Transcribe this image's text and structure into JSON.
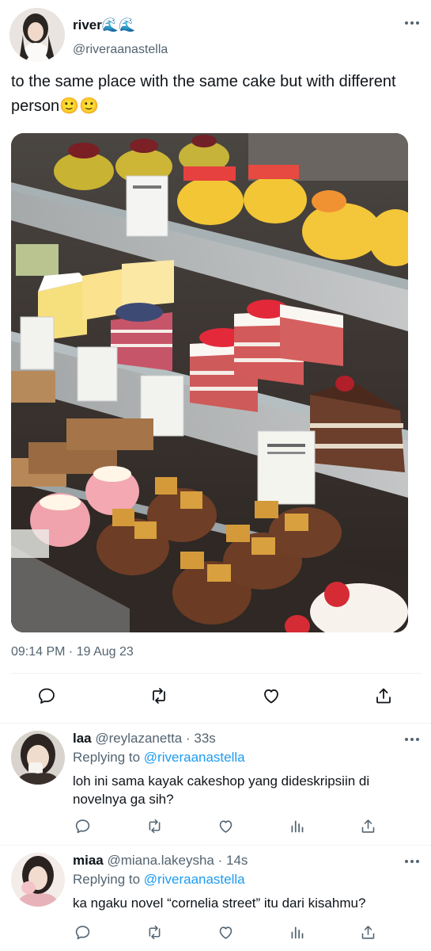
{
  "tweet": {
    "author_name": "river🌊🌊",
    "author_handle": "@riveraanastella",
    "text": "to the same place with the same cake but with different person🙂🙂",
    "timestamp": "09:14 PM · 19 Aug 23"
  },
  "actions": [
    "reply-icon",
    "retweet-icon",
    "like-icon",
    "share-icon"
  ],
  "replies": [
    {
      "name": "laa",
      "handle": "@reylazanetta",
      "time": "· 33s",
      "replying_label": "Replying to",
      "replying_to": "@riveraanastella",
      "text": "loh ini sama kayak cakeshop yang dideskripsiin di novelnya ga sih?"
    },
    {
      "name": "miaa",
      "handle": "@miana.lakeysha",
      "time": "· 14s",
      "replying_label": "Replying to",
      "replying_to": "@riveraanastella",
      "text": "ka ngaku novel “cornelia street” itu dari kisahmu?"
    }
  ],
  "colors": {
    "text": "#0f1419",
    "secondary": "#536471",
    "link": "#1d9bf0",
    "divider": "#eff3f4"
  }
}
